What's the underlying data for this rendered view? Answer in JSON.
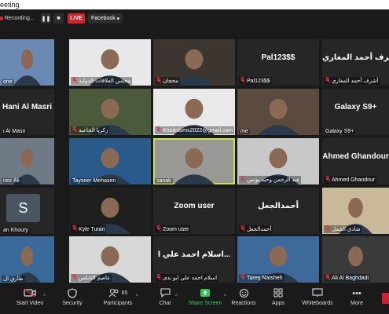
{
  "window": {
    "title": "eeting"
  },
  "topbar": {
    "recording": "Recording...",
    "pause": "❚❚",
    "stop": "■",
    "live": "LIVE",
    "stream_target": "Facebook",
    "stream_caret": "▾"
  },
  "tiles": [
    {
      "name": "one",
      "big": "",
      "muted": false,
      "active": false
    },
    {
      "name": "مجلس العلاقات الدولية",
      "big": "",
      "muted": true,
      "active": false
    },
    {
      "name": "محجان",
      "big": "",
      "muted": true,
      "active": false
    },
    {
      "name": "Pal123$$",
      "big": "Pal123$$",
      "muted": true,
      "active": false
    },
    {
      "name": "أشرف أحمد المغاري",
      "big": "أشرف أحمد المغاري",
      "muted": true,
      "active": false
    },
    {
      "name": "i Al Masri",
      "big": "Hani Al Masri",
      "muted": false,
      "active": false
    },
    {
      "name": "زكريا الجاعبة",
      "big": "",
      "muted": true,
      "active": false
    },
    {
      "name": "Khaledsms2022@gmail.com",
      "big": "",
      "muted": true,
      "active": false
    },
    {
      "name": "me",
      "big": "",
      "muted": false,
      "active": false
    },
    {
      "name": "Galaxy S9+",
      "big": "Galaxy S9+",
      "muted": false,
      "active": false
    },
    {
      "name": "nez Ali",
      "big": "",
      "muted": false,
      "active": false
    },
    {
      "name": "Tayseer Mehasen",
      "big": "",
      "muted": false,
      "active": false
    },
    {
      "name": "sanak",
      "big": "",
      "muted": false,
      "active": true
    },
    {
      "name": "عبد الرحمن وحيه يونس",
      "big": "",
      "muted": true,
      "active": false
    },
    {
      "name": "Ahmed Ghandour",
      "big": "Ahmed Ghandour",
      "muted": true,
      "active": false
    },
    {
      "name": "an Khoury",
      "big": "",
      "muted": false,
      "active": false
    },
    {
      "name": "Kyle Turan",
      "big": "",
      "muted": true,
      "active": false
    },
    {
      "name": "Zoom user",
      "big": "Zoom user",
      "muted": true,
      "active": false
    },
    {
      "name": "أحمدالجعل",
      "big": "أحمدالجعل",
      "muted": true,
      "active": false
    },
    {
      "name": "شادي الجمل",
      "big": "",
      "muted": true,
      "active": false
    },
    {
      "name": "طارق ال",
      "big": "",
      "muted": false,
      "active": false
    },
    {
      "name": "عاصم النابلس",
      "big": "",
      "muted": true,
      "active": false
    },
    {
      "name": "اسلام احمد علي ابو ندى",
      "big": "اسلام احمد علي ا...",
      "muted": true,
      "active": false
    },
    {
      "name": "Tareq Natsheh",
      "big": "",
      "muted": true,
      "active": false
    },
    {
      "name": "Ali Al Baghdadi",
      "big": "",
      "muted": true,
      "active": false
    }
  ],
  "avatar_letter": "S",
  "toolbar": {
    "start_video": "Start Video",
    "security": "Security",
    "participants": "Participants",
    "participants_count": "65",
    "chat": "Chat",
    "share_screen": "Share Screen",
    "reactions": "Reactions",
    "apps": "Apps",
    "whiteboards": "Whiteboards",
    "more": "More"
  }
}
